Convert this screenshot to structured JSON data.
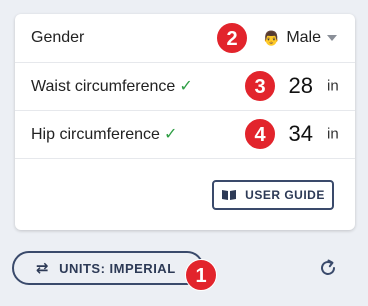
{
  "form": {
    "gender": {
      "label": "Gender",
      "value": "Male",
      "icon": "male-face-icon",
      "marker": "2"
    },
    "waist": {
      "label": "Waist circumference",
      "check": "✓",
      "value": "28",
      "unit": "in",
      "marker": "3"
    },
    "hip": {
      "label": "Hip circumference",
      "check": "✓",
      "value": "34",
      "unit": "in",
      "marker": "4"
    }
  },
  "user_guide": {
    "label": "USER GUIDE",
    "icon": "book-icon"
  },
  "units": {
    "label": "UNITS: IMPERIAL",
    "icon": "swap-icon",
    "marker": "1"
  },
  "reset": {
    "icon": "refresh-icon"
  },
  "colors": {
    "marker": "#e2242c",
    "accent": "#3a4a6b",
    "check": "#2e9e44"
  }
}
